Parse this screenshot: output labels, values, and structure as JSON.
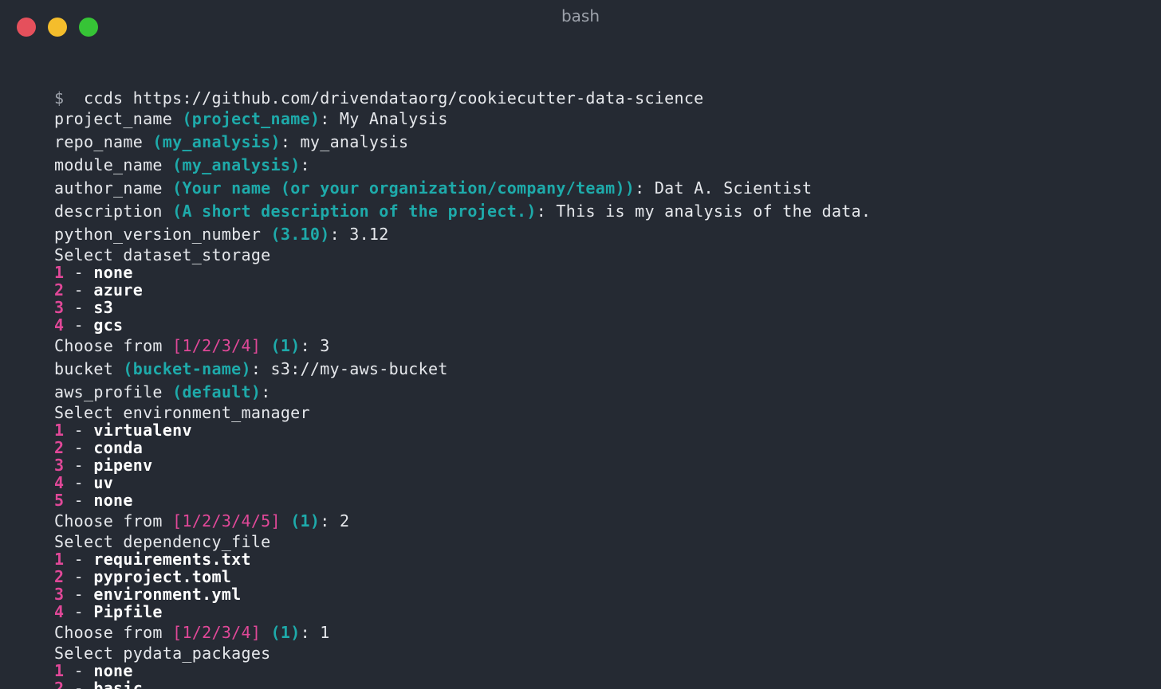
{
  "window": {
    "title": "bash",
    "controls": {
      "close": "#e5505c",
      "minimize": "#f4bd2c",
      "maximize": "#36c436"
    }
  },
  "colors": {
    "accent_cyan": "#1eaaaa",
    "accent_pink": "#e04898",
    "background": "#252a33"
  },
  "terminal": {
    "prompt_symbol": "$",
    "command": "ccds https://github.com/drivendataorg/cookiecutter-data-science",
    "project_name": {
      "key": "project_name",
      "default": "(project_name)",
      "value": "My Analysis"
    },
    "repo_name": {
      "key": "repo_name",
      "default": "(my_analysis)",
      "value": "my_analysis"
    },
    "module_name": {
      "key": "module_name",
      "default": "(my_analysis)",
      "value": ""
    },
    "author_name": {
      "key": "author_name",
      "default": "(Your name (or your organization/company/team))",
      "value": "Dat A. Scientist"
    },
    "description": {
      "key": "description",
      "default": "(A short description of the project.)",
      "value": "This is my analysis of the data."
    },
    "python_version": {
      "key": "python_version_number",
      "default": "(3.10)",
      "value": "3.12"
    },
    "dataset_storage": {
      "heading": "Select dataset_storage",
      "options": [
        {
          "n": "1",
          "label": "none"
        },
        {
          "n": "2",
          "label": "azure"
        },
        {
          "n": "3",
          "label": "s3"
        },
        {
          "n": "4",
          "label": "gcs"
        }
      ],
      "choose_label": "Choose from",
      "choices": "[1/2/3/4]",
      "default": "(1)",
      "value": "3"
    },
    "bucket": {
      "key": "bucket",
      "default": "(bucket-name)",
      "value": "s3://my-aws-bucket"
    },
    "aws_profile": {
      "key": "aws_profile",
      "default": "(default)",
      "value": ""
    },
    "environment_manager": {
      "heading": "Select environment_manager",
      "options": [
        {
          "n": "1",
          "label": "virtualenv"
        },
        {
          "n": "2",
          "label": "conda"
        },
        {
          "n": "3",
          "label": "pipenv"
        },
        {
          "n": "4",
          "label": "uv"
        },
        {
          "n": "5",
          "label": "none"
        }
      ],
      "choose_label": "Choose from",
      "choices": "[1/2/3/4/5]",
      "default": "(1)",
      "value": "2"
    },
    "dependency_file": {
      "heading": "Select dependency_file",
      "options": [
        {
          "n": "1",
          "label": "requirements.txt"
        },
        {
          "n": "2",
          "label": "pyproject.toml"
        },
        {
          "n": "3",
          "label": "environment.yml"
        },
        {
          "n": "4",
          "label": "Pipfile"
        }
      ],
      "choose_label": "Choose from",
      "choices": "[1/2/3/4]",
      "default": "(1)",
      "value": "1"
    },
    "pydata_packages": {
      "heading": "Select pydata_packages",
      "options": [
        {
          "n": "1",
          "label": "none"
        },
        {
          "n": "2",
          "label": "basic"
        }
      ]
    }
  }
}
